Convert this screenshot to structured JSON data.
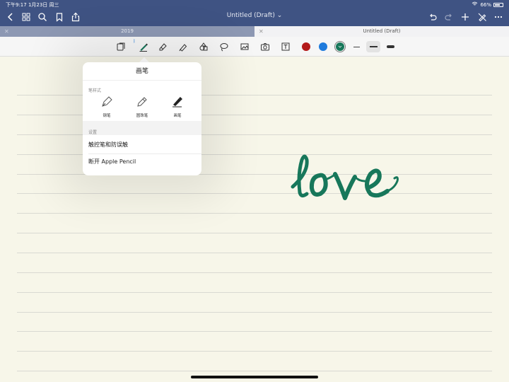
{
  "status_bar": {
    "time_date": "下午9:17 1月23日 周三",
    "battery": "66%"
  },
  "document": {
    "title": "Untitled (Draft) ⌄"
  },
  "tabs": [
    {
      "label": "2019"
    },
    {
      "label": "Untitled (Draft)"
    }
  ],
  "colors": {
    "nav_bar": "#3f5383",
    "ink_green": "#17775a",
    "red": "#b31a1a",
    "blue": "#1f7bdc",
    "green": "#17775a"
  },
  "handwriting": {
    "text": "love"
  },
  "pen_popover": {
    "title": "画笔",
    "style_section": "笔样式",
    "pens": [
      {
        "label": "钢笔"
      },
      {
        "label": "圆珠笔"
      },
      {
        "label": "画笔"
      }
    ],
    "settings_section": "设置",
    "settings_items": [
      {
        "label": "触控笔和防误触"
      },
      {
        "label": "断开 Apple Pencil"
      }
    ]
  }
}
